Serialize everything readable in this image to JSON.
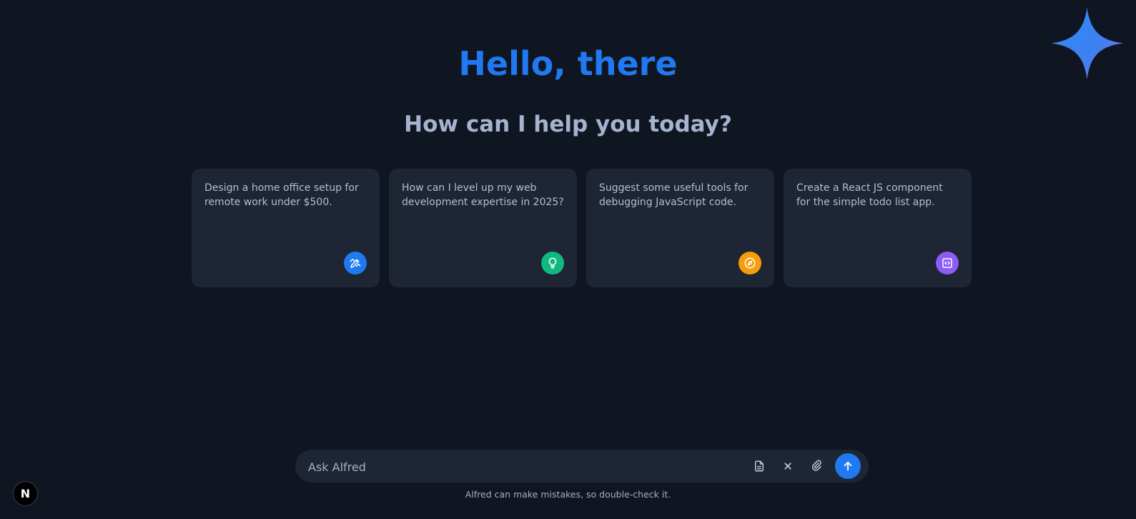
{
  "header": {
    "greeting": "Hello, there",
    "subtitle": "How can I help you today?",
    "logo_icon": "sparkle-star-icon"
  },
  "suggestions": [
    {
      "text": "Design a home office setup for remote work under $500.",
      "icon": "pen-ruler-icon",
      "icon_color": "#2079f0"
    },
    {
      "text": "How can I level up my web development expertise in 2025?",
      "icon": "lightbulb-icon",
      "icon_color": "#10b981"
    },
    {
      "text": "Suggest some useful tools for debugging JavaScript code.",
      "icon": "compass-icon",
      "icon_color": "#f59e0b"
    },
    {
      "text": "Create a React JS component for the simple todo list app.",
      "icon": "code-icon",
      "icon_color": "#8b5cf6"
    }
  ],
  "input": {
    "placeholder": "Ask Alfred",
    "value": ""
  },
  "toolbar": {
    "document_icon": "document-icon",
    "clear_icon": "close-icon",
    "attach_icon": "paperclip-icon",
    "send_icon": "arrow-up-icon"
  },
  "disclaimer": "Alfred can make mistakes, so double-check it.",
  "badge": {
    "letter": "N"
  },
  "colors": {
    "background": "#0f1521",
    "surface": "#1e2535",
    "accent": "#2079f0",
    "muted_text": "#a5b3cf"
  }
}
